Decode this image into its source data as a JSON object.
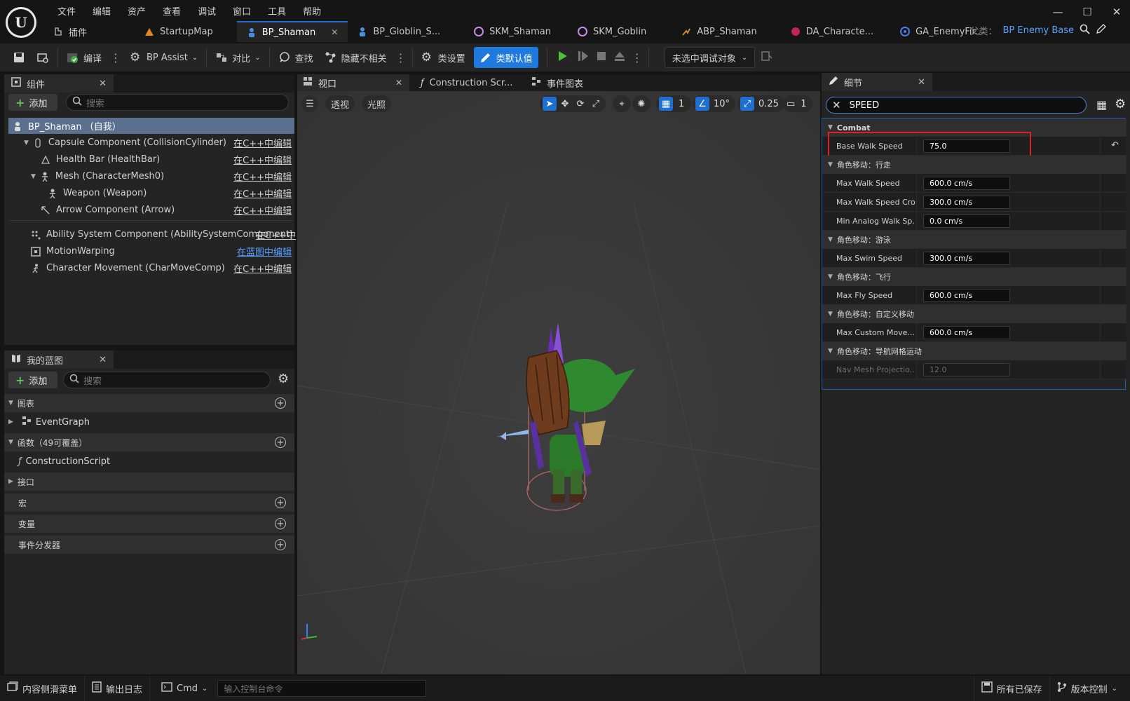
{
  "menu": [
    "文件",
    "编辑",
    "资产",
    "查看",
    "调试",
    "窗口",
    "工具",
    "帮助"
  ],
  "tabs": [
    {
      "label": "插件",
      "icon": "plugin-icon"
    },
    {
      "label": "StartupMap",
      "icon": "map-icon"
    },
    {
      "label": "BP_Shaman",
      "icon": "blueprint-character-icon",
      "active": true
    },
    {
      "label": "BP_Globlin_S...",
      "icon": "blueprint-character-icon"
    },
    {
      "label": "SKM_Shaman",
      "icon": "skeletal-mesh-icon"
    },
    {
      "label": "SKM_Goblin",
      "icon": "skeletal-mesh-icon"
    },
    {
      "label": "ABP_Shaman",
      "icon": "anim-blueprint-icon"
    },
    {
      "label": "DA_Characte...",
      "icon": "data-asset-icon"
    },
    {
      "label": "GA_EnemyFir...",
      "icon": "gameplay-ability-icon"
    }
  ],
  "parent_class": {
    "label": "父类：",
    "value": "BP Enemy Base"
  },
  "toolbar": {
    "compile": "编译",
    "bp_assist": "BP Assist",
    "diff": "对比",
    "find": "查找",
    "hide_unrelated": "隐藏不相关",
    "class_settings": "类设置",
    "class_defaults": "类默认值",
    "debug_object": "未选中调试对象"
  },
  "components_panel": {
    "title": "组件",
    "add": "添加",
    "search_placeholder": "搜索",
    "items": [
      {
        "label": "BP_Shaman （自我）",
        "edit": ""
      },
      {
        "label": "Capsule Component (CollisionCylinder)",
        "edit": "在C++中编辑"
      },
      {
        "label": "Health Bar (HealthBar)",
        "edit": "在C++中编辑"
      },
      {
        "label": "Mesh (CharacterMesh0)",
        "edit": "在C++中编辑"
      },
      {
        "label": "Weapon (Weapon)",
        "edit": "在C++中编辑"
      },
      {
        "label": "Arrow Component (Arrow)",
        "edit": "在C++中编辑"
      },
      {
        "label": "Ability System Component (AbilitySystemComponent)",
        "edit": "在C++中"
      },
      {
        "label": "MotionWarping",
        "edit": "在蓝图中编辑"
      },
      {
        "label": "Character Movement (CharMoveComp)",
        "edit": "在C++中编辑"
      }
    ]
  },
  "my_blueprint": {
    "title": "我的蓝图",
    "add": "添加",
    "search_placeholder": "搜索",
    "sections": {
      "graphs": "图表",
      "event_graph": "EventGraph",
      "functions": "函数（49可覆盖）",
      "construction_script": "ConstructionScript",
      "interfaces": "接口",
      "macros": "宏",
      "variables": "变量",
      "dispatchers": "事件分发器"
    }
  },
  "viewport_tabs": {
    "viewport": "视口",
    "construction": "Construction Scr...",
    "event_graph": "事件图表"
  },
  "viewport_toolbar": {
    "perspective": "透视",
    "lit": "光照",
    "grid_snap": "1",
    "rotation_snap": "10°",
    "scale_snap": "0.25",
    "camera_speed": "1"
  },
  "details": {
    "title": "细节",
    "search_value": "SPEED",
    "categories": [
      {
        "name": "Combat",
        "rows": [
          {
            "label": "Base Walk Speed",
            "value": "75.0",
            "highlight": true
          }
        ]
      },
      {
        "name": "角色移动：行走",
        "rows": [
          {
            "label": "Max Walk Speed",
            "value": "600.0 cm/s"
          },
          {
            "label": "Max Walk Speed Cro...",
            "value": "300.0 cm/s"
          },
          {
            "label": "Min Analog Walk Sp...",
            "value": "0.0 cm/s"
          }
        ]
      },
      {
        "name": "角色移动：游泳",
        "rows": [
          {
            "label": "Max Swim Speed",
            "value": "300.0 cm/s"
          }
        ]
      },
      {
        "name": "角色移动：飞行",
        "rows": [
          {
            "label": "Max Fly Speed",
            "value": "600.0 cm/s"
          }
        ]
      },
      {
        "name": "角色移动：自定义移动",
        "rows": [
          {
            "label": "Max Custom Move...",
            "value": "600.0 cm/s"
          }
        ]
      },
      {
        "name": "角色移动：导航网格运动",
        "rows": [
          {
            "label": "Nav Mesh Projectio...",
            "value": "12.0",
            "disabled": true
          }
        ]
      }
    ]
  },
  "statusbar": {
    "content_drawer": "内容侧滑菜单",
    "output_log": "输出日志",
    "cmd": "Cmd",
    "console_placeholder": "输入控制台命令",
    "all_saved": "所有已保存",
    "source_control": "版本控制"
  },
  "colors": {
    "accent": "#1f7ae0",
    "highlight_box": "#e02020",
    "play": "#4fbf3b"
  }
}
